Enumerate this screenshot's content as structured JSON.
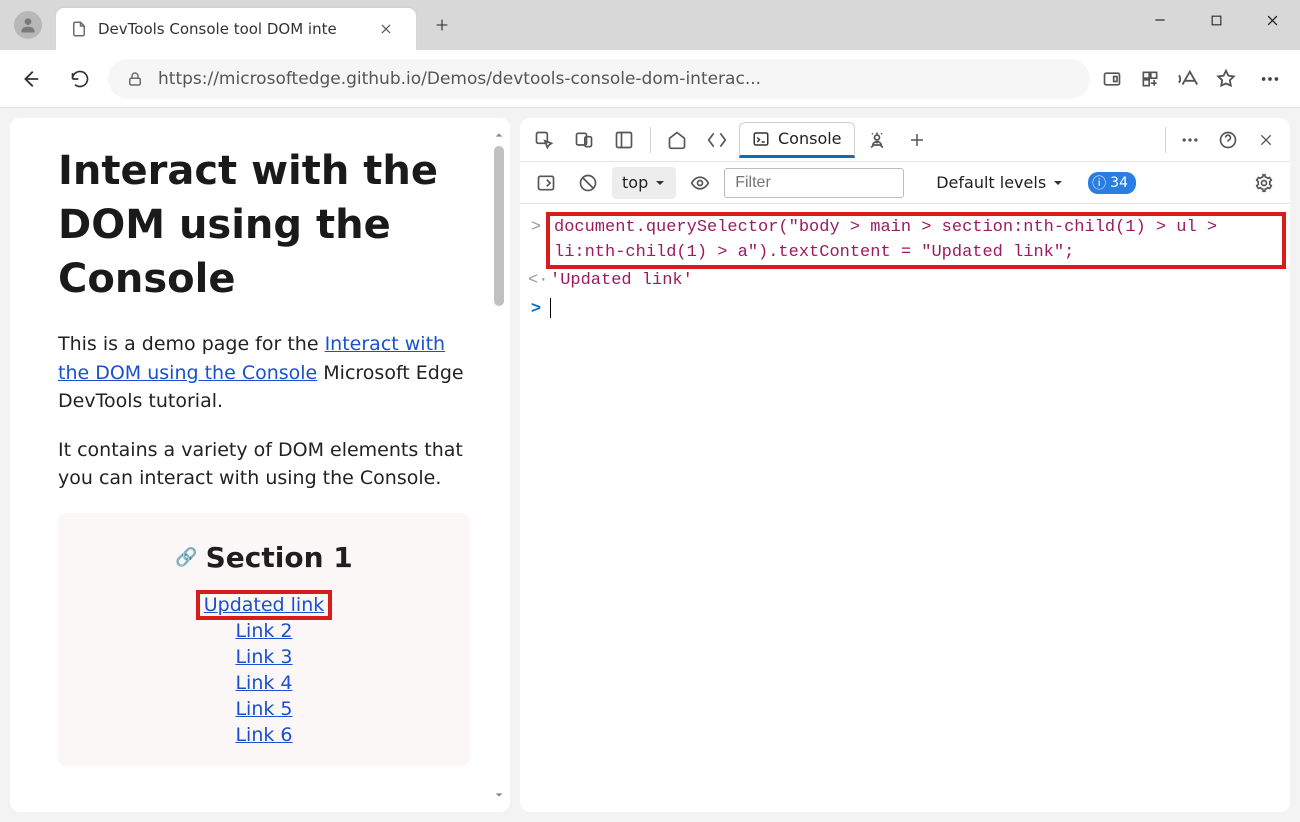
{
  "browser": {
    "tab_title": "DevTools Console tool DOM inte",
    "url_display": "https://microsoftedge.github.io/Demos/devtools-console-dom-interac..."
  },
  "page": {
    "heading": "Interact with the DOM using the Console",
    "intro_before_link": "This is a demo page for the ",
    "intro_link": "Interact with the DOM using the Console",
    "intro_after_link": " Microsoft Edge DevTools tutorial.",
    "para2": "It contains a variety of DOM elements that you can interact with using the Console.",
    "section": {
      "title": "Section 1",
      "links": [
        "Updated link",
        "Link 2",
        "Link 3",
        "Link 4",
        "Link 5",
        "Link 6"
      ]
    }
  },
  "devtools": {
    "tabs": {
      "active": "Console"
    },
    "toolbar": {
      "context": "top",
      "filter_placeholder": "Filter",
      "levels_label": "Default levels",
      "issues_count": "34"
    },
    "console": {
      "input_code": "document.querySelector(\"body > main > section:nth-child(1) > ul > li:nth-child(1) > a\").textContent = \"Updated link\";",
      "result": "'Updated link'"
    }
  }
}
